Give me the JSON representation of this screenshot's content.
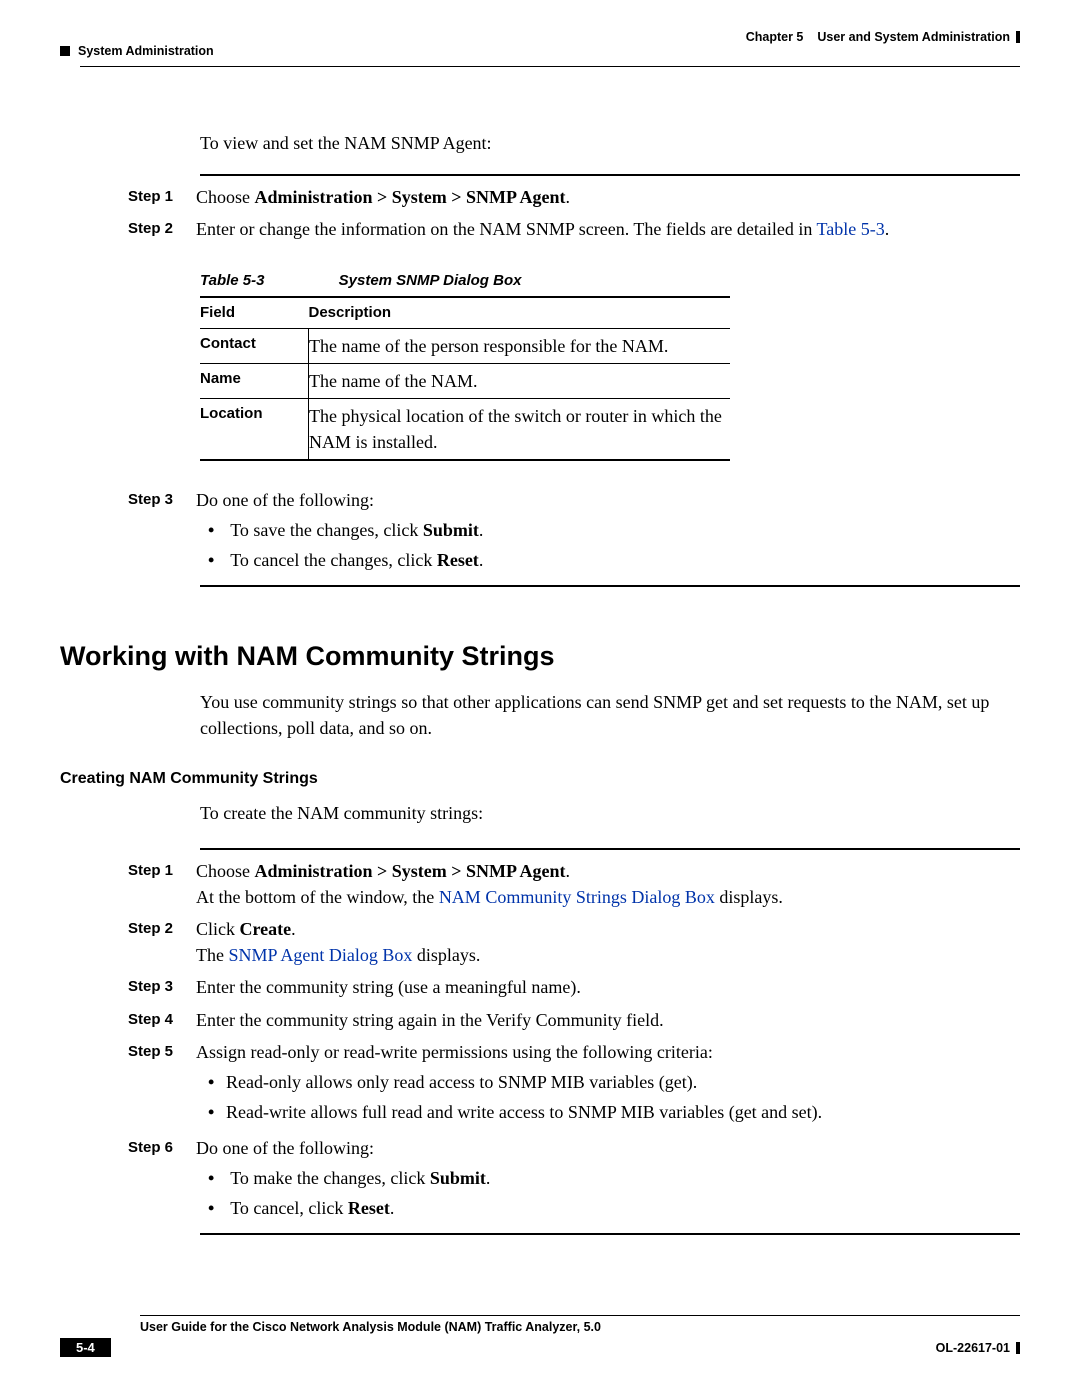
{
  "header": {
    "chapter_label": "Chapter 5",
    "chapter_title": "User and System Administration",
    "section": "System Administration"
  },
  "section1": {
    "intro": "To view and set the NAM SNMP Agent:",
    "steps": {
      "s1_label": "Step 1",
      "s1_pre": "Choose ",
      "s1_bold": "Administration > System > SNMP Agent",
      "s1_post": ".",
      "s2_label": "Step 2",
      "s2_pre": "Enter or change the information on the NAM SNMP screen. The fields are detailed in ",
      "s2_link": "Table 5-3",
      "s2_post": "."
    },
    "table": {
      "caption_num": "Table 5-3",
      "caption_title": "System SNMP Dialog Box",
      "col1": "Field",
      "col2": "Description",
      "rows": [
        {
          "field": "Contact",
          "desc": "The name of the person responsible for the NAM."
        },
        {
          "field": "Name",
          "desc": "The name of the NAM."
        },
        {
          "field": "Location",
          "desc": "The physical location of the switch or router in which the NAM is installed."
        }
      ]
    },
    "step3": {
      "label": "Step 3",
      "text": "Do one of the following:",
      "b1_pre": "To save the changes, click ",
      "b1_bold": "Submit",
      "b1_post": ".",
      "b2_pre": "To cancel the changes, click ",
      "b2_bold": "Reset",
      "b2_post": "."
    }
  },
  "section2": {
    "heading": "Working with NAM Community Strings",
    "para": "You use community strings so that other applications can send SNMP get and set requests to the NAM, set up collections, poll data, and so on.",
    "subheading": "Creating NAM Community Strings",
    "intro": "To create the NAM community strings:",
    "steps": {
      "s1_label": "Step 1",
      "s1_pre": "Choose ",
      "s1_bold": "Administration > System > SNMP Agent",
      "s1_post": ".",
      "s1_line2_pre": "At the bottom of the window, the ",
      "s1_line2_link": "NAM Community Strings Dialog Box",
      "s1_line2_post": " displays.",
      "s2_label": "Step 2",
      "s2_pre": "Click ",
      "s2_bold": "Create",
      "s2_post": ".",
      "s2_line2_pre": "The ",
      "s2_line2_link": "SNMP Agent Dialog Box",
      "s2_line2_post": " displays.",
      "s3_label": "Step 3",
      "s3_text": "Enter the community string (use a meaningful name).",
      "s4_label": "Step 4",
      "s4_text": "Enter the community string again in the Verify Community field.",
      "s5_label": "Step 5",
      "s5_text": "Assign read-only or read-write permissions using the following criteria:",
      "s5_b1": "Read-only allows only read access to SNMP MIB variables (get).",
      "s5_b2": "Read-write allows full read and write access to SNMP MIB variables (get and set).",
      "s6_label": "Step 6",
      "s6_text": "Do one of the following:",
      "s6_b1_pre": "To make the changes, click ",
      "s6_b1_bold": "Submit",
      "s6_b1_post": ".",
      "s6_b2_pre": "To cancel, click ",
      "s6_b2_bold": "Reset",
      "s6_b2_post": "."
    }
  },
  "footer": {
    "guide_title": "User Guide for the Cisco Network Analysis Module (NAM) Traffic Analyzer, 5.0",
    "page_num": "5-4",
    "doc_id": "OL-22617-01"
  }
}
